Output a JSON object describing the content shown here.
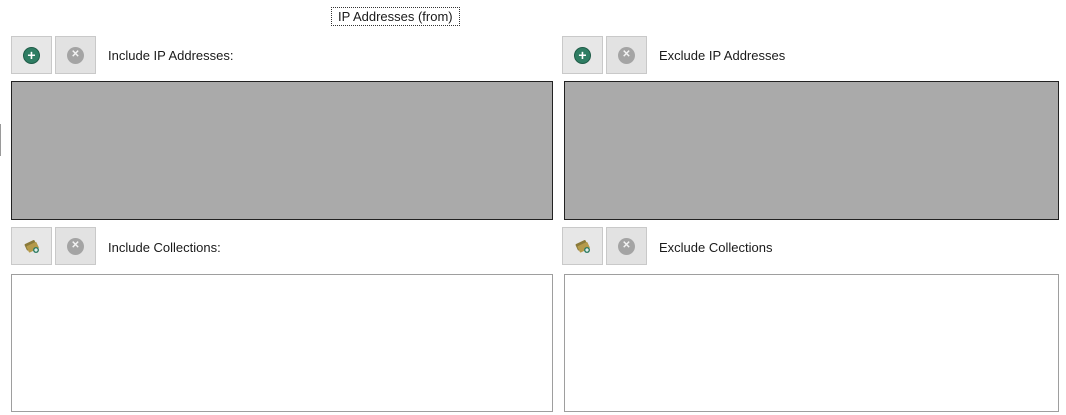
{
  "tab": {
    "title": "IP Addresses (from)"
  },
  "include_ip": {
    "label": "Include IP Addresses:",
    "add_icon": "add-circle-icon",
    "remove_icon": "remove-circle-icon"
  },
  "exclude_ip": {
    "label": "Exclude IP Addresses",
    "add_icon": "add-circle-icon",
    "remove_icon": "remove-circle-icon"
  },
  "include_collections": {
    "label": "Include Collections:",
    "add_icon": "add-collection-icon",
    "remove_icon": "remove-circle-icon"
  },
  "exclude_collections": {
    "label": "Exclude Collections",
    "add_icon": "add-collection-icon",
    "remove_icon": "remove-circle-icon"
  },
  "colors": {
    "disabled_list_bg": "#aaaaaa",
    "add_green": "#2f7d63",
    "remove_grey": "#a4a4a4"
  }
}
